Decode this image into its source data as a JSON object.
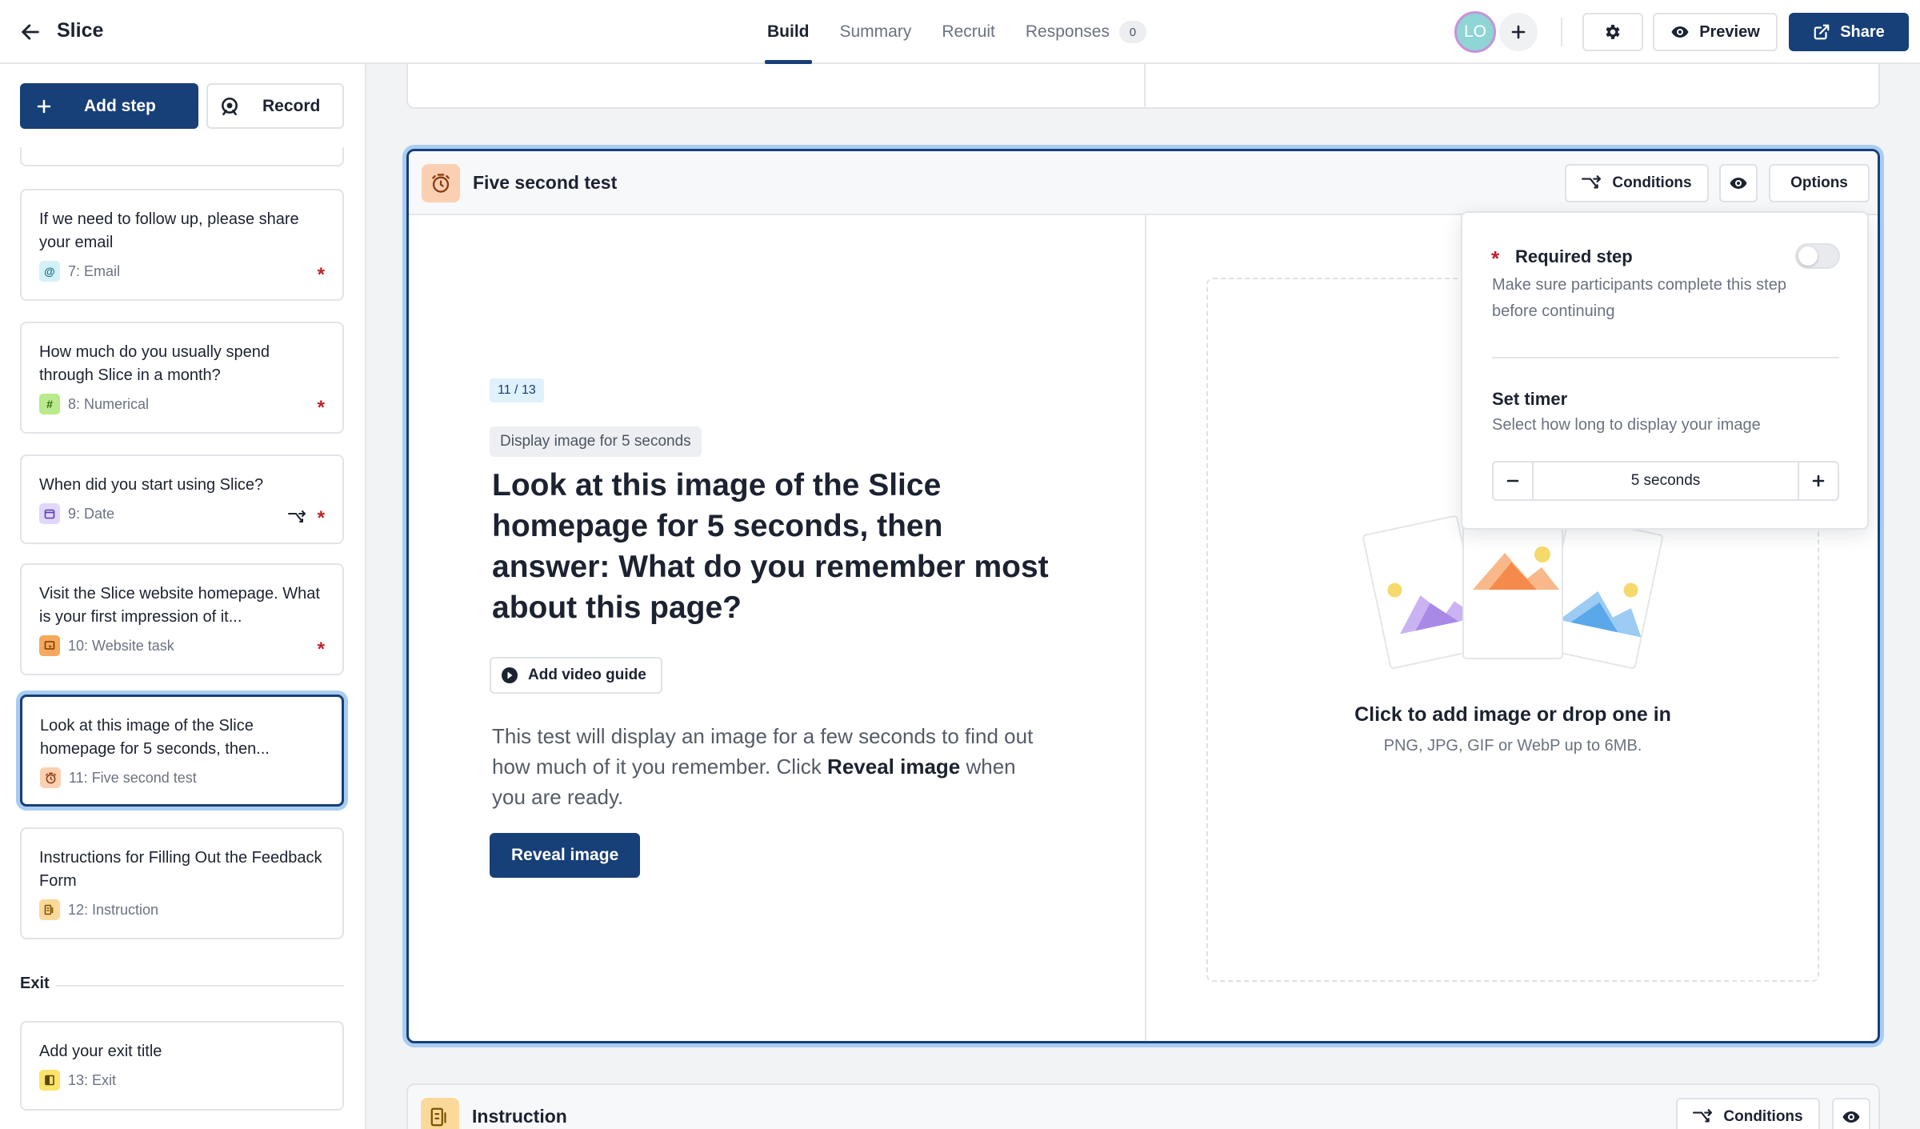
{
  "header": {
    "app_title": "Slice",
    "tabs": [
      {
        "label": "Build",
        "active": true
      },
      {
        "label": "Summary"
      },
      {
        "label": "Recruit"
      },
      {
        "label": "Responses",
        "badge": "0"
      }
    ],
    "avatar_initials": "LO",
    "preview_label": "Preview",
    "share_label": "Share"
  },
  "sidebar": {
    "add_step_label": "Add step",
    "record_label": "Record",
    "steps": [
      {
        "title": "If we need to follow up, please share your email",
        "meta": "7: Email",
        "icon": "at-icon",
        "required": true
      },
      {
        "title": "How much do you usually spend through Slice in a month?",
        "meta": "8: Numerical",
        "icon": "hash-icon",
        "required": true
      },
      {
        "title": "When did you start using Slice?",
        "meta": "9: Date",
        "icon": "calendar-icon",
        "required": true,
        "has_conditions": true
      },
      {
        "title": "Visit the Slice website homepage. What is your first impression of it...",
        "meta": "10: Website task",
        "icon": "website-icon",
        "required": true
      },
      {
        "title": "Look at this image of the Slice homepage for 5 seconds, then...",
        "meta": "11: Five second test",
        "icon": "timer-icon",
        "selected": true
      },
      {
        "title": "Instructions for Filling Out the Feedback Form",
        "meta": "12: Instruction",
        "icon": "instruction-icon"
      }
    ],
    "exit_section_label": "Exit",
    "exit_step": {
      "title": "Add your exit title",
      "meta": "13: Exit",
      "icon": "exit-icon"
    }
  },
  "block": {
    "title": "Five second test",
    "conditions_label": "Conditions",
    "options_label": "Options",
    "progress": "11 / 13",
    "display_pill": "Display image for 5 seconds",
    "question": "Look at this image of the Slice homepage for 5 seconds, then answer: What do you remember most about this page?",
    "video_guide_label": "Add video guide",
    "description_part1": "This test will display an image for a few seconds to find out how much of it you remember. Click ",
    "description_bold": "Reveal image",
    "description_part2": " when you are ready.",
    "reveal_label": "Reveal image",
    "drop_title": "Click to add image or drop one in",
    "drop_subtitle": "PNG, JPG, GIF or WebP up to 6MB."
  },
  "options_popover": {
    "required_title": "Required step",
    "required_desc": "Make sure participants complete this step before continuing",
    "required_enabled": false,
    "timer_title": "Set timer",
    "timer_desc": "Select how long to display your image",
    "timer_value": "5 seconds"
  },
  "next_block": {
    "title": "Instruction",
    "conditions_label": "Conditions"
  },
  "colors": {
    "primary": "#173f78",
    "selection_ring": "#a9cdf2",
    "required": "#c0202a",
    "progress_bg": "#dff1fb"
  }
}
